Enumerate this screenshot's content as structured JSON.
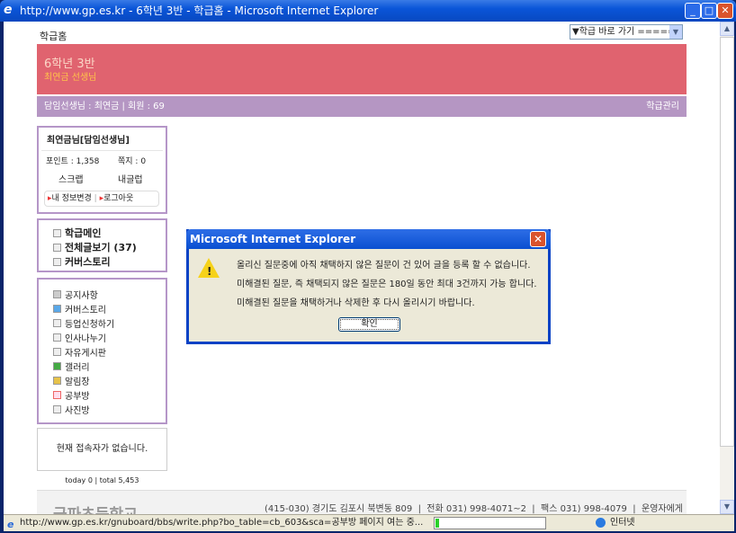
{
  "window": {
    "title": "http://www.gp.es.kr - 6학년 3반 - 학급홈 - Microsoft Internet Explorer"
  },
  "header": {
    "home_link": "학급홈",
    "class_select": "▼학급 바로 가기 ====="
  },
  "banner": {
    "class_name": "6학년 3반",
    "teacher": "최연금 선생님"
  },
  "infobar": {
    "teacher_label": "담임선생님 : 최연금 | 회원 : 69",
    "manage_link": "학급관리"
  },
  "user_box": {
    "name": "최연금님[담임선생님]",
    "points": "포인트 : 1,358",
    "memo": "쪽지 : 0",
    "scrap": "스크랩",
    "my_posts": "내글럽",
    "edit_info": "내 정보변경",
    "logout": "로그아웃"
  },
  "main_menu": [
    {
      "label": "학급메인"
    },
    {
      "label": "전체글보기 (37)"
    },
    {
      "label": "커버스토리"
    }
  ],
  "board_menu": [
    {
      "label": "공지사항",
      "icon": "notice-icon"
    },
    {
      "label": "커버스토리",
      "icon": "cover-icon"
    },
    {
      "label": "등업신청하기",
      "icon": "board-icon"
    },
    {
      "label": "인사나누기",
      "icon": "board-icon"
    },
    {
      "label": "자유게시판",
      "icon": "board-icon"
    },
    {
      "label": "갤러리",
      "icon": "gallery-icon"
    },
    {
      "label": "알림장",
      "icon": "notebook-icon"
    },
    {
      "label": "공부방",
      "icon": "study-icon"
    },
    {
      "label": "사진방",
      "icon": "board-icon"
    }
  ],
  "visitors": {
    "message": "현재 접속자가 없습니다.",
    "counter": "today 0 | total 5,453"
  },
  "footer": {
    "school": "금파초등학교",
    "address": "(415-030) 경기도 김포시 북변동 809  |  전화 031) 998-4071~2  |  팩스 031) 998-4079  |  운영자에게"
  },
  "dialog": {
    "title": "Microsoft Internet Explorer",
    "lines": [
      "올리신 질문중에 아직 채택하지 않은 질문이 건 있어 글을 등록 할 수 없습니다.",
      "미해결된 질문, 즉 채택되지 않은 질문은 180일 동안 최대 3건까지 가능 합니다.",
      "미해결된 질문을 채택하거나 삭제한 후 다시 올리시기 바랍니다."
    ],
    "ok": "확인"
  },
  "statusbar": {
    "text": "http://www.gp.es.kr/gnuboard/bbs/write.php?bo_table=cb_603&sca=공부방 페이지 여는 중...",
    "progress": 0.03,
    "zone": "인터넷"
  }
}
